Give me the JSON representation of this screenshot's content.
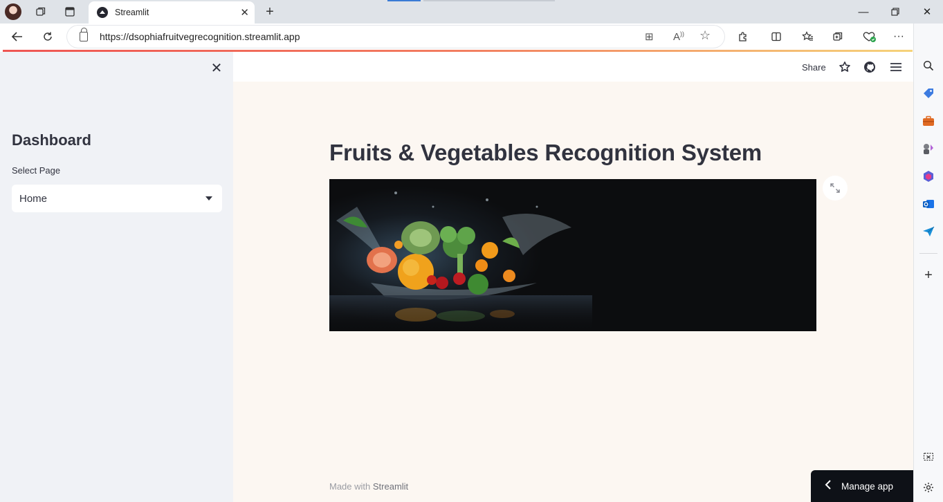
{
  "browser": {
    "tab_title": "Streamlit",
    "url": "https://dsophiafruitvegrecognition.streamlit.app",
    "icons": {
      "tab_actions": "tab-actions-icon",
      "vertical_tabs": "vertical-tabs-icon",
      "new_tab": "plus-icon",
      "back": "back-arrow-icon",
      "refresh": "refresh-icon",
      "lock": "lock-icon",
      "read_aloud": "read-aloud-icon",
      "favorite": "star-icon"
    }
  },
  "streamlit": {
    "sidebar": {
      "title": "Dashboard",
      "select_label": "Select Page",
      "select_value": "Home"
    },
    "header": {
      "share_label": "Share"
    },
    "main": {
      "title": "Fruits & Vegetables Recognition System"
    },
    "footer": {
      "made_with": "Made with",
      "brand": "Streamlit"
    },
    "manage_app": "Manage app"
  },
  "colors": {
    "sidebar_bg": "#f0f2f6",
    "main_bg": "#fcf7f2",
    "text": "#31333f",
    "manage_bg": "#0e1117"
  }
}
